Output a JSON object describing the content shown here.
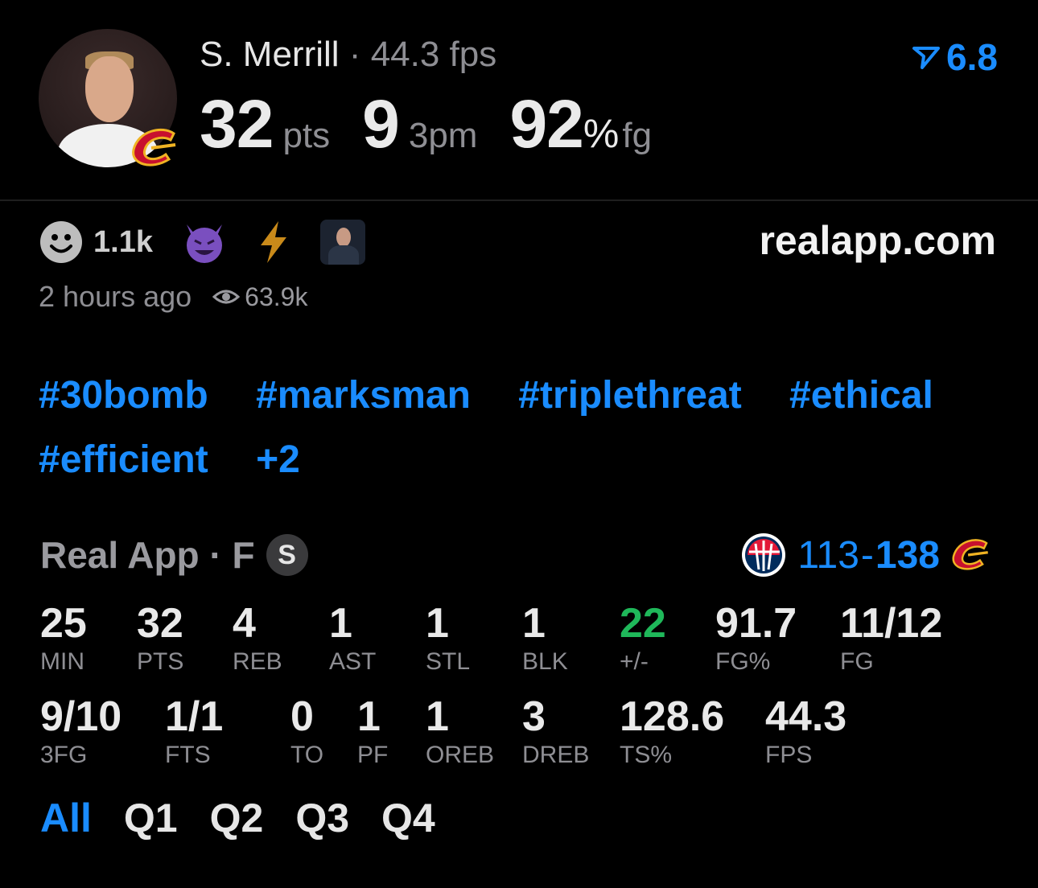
{
  "player": {
    "name": "S. Merrill",
    "separator": "·",
    "fps_text": "44.3 fps",
    "pts_value": "32",
    "pts_unit": "pts",
    "tpm_value": "9",
    "tpm_unit": "3pm",
    "fg_value": "92",
    "fg_percent": "%",
    "fg_unit": "fg"
  },
  "rank": {
    "value": "6.8",
    "color": "#1a8cff"
  },
  "reactions": {
    "count": "1.1k"
  },
  "site": "realapp.com",
  "meta": {
    "time": "2 hours ago",
    "views": "63.9k"
  },
  "hashtags": [
    "#30bomb",
    "#marksman",
    "#triplethreat",
    "#ethical",
    "#efficient",
    "+2"
  ],
  "game": {
    "source": "Real App · F",
    "badge": "S",
    "away_score": "113",
    "dash": "-",
    "home_score": "138"
  },
  "stats_row1": [
    {
      "value": "25",
      "label": "MIN"
    },
    {
      "value": "32",
      "label": "PTS"
    },
    {
      "value": "4",
      "label": "REB"
    },
    {
      "value": "1",
      "label": "AST"
    },
    {
      "value": "1",
      "label": "STL"
    },
    {
      "value": "1",
      "label": "BLK"
    },
    {
      "value": "22",
      "label": "+/-"
    },
    {
      "value": "91.7",
      "label": "FG%"
    },
    {
      "value": "11/12",
      "label": "FG"
    }
  ],
  "stats_row2": [
    {
      "value": "9/10",
      "label": "3FG"
    },
    {
      "value": "1/1",
      "label": "FTS"
    },
    {
      "value": "0",
      "label": "TO"
    },
    {
      "value": "1",
      "label": "PF"
    },
    {
      "value": "1",
      "label": "OREB"
    },
    {
      "value": "3",
      "label": "DREB"
    },
    {
      "value": "128.6",
      "label": "TS%"
    },
    {
      "value": "44.3",
      "label": "FPS"
    }
  ],
  "tabs": [
    "All",
    "Q1",
    "Q2",
    "Q3",
    "Q4"
  ],
  "colors": {
    "accent": "#1a8cff",
    "positive": "#1fb85a",
    "muted": "#8e8e93",
    "background": "#000000"
  }
}
